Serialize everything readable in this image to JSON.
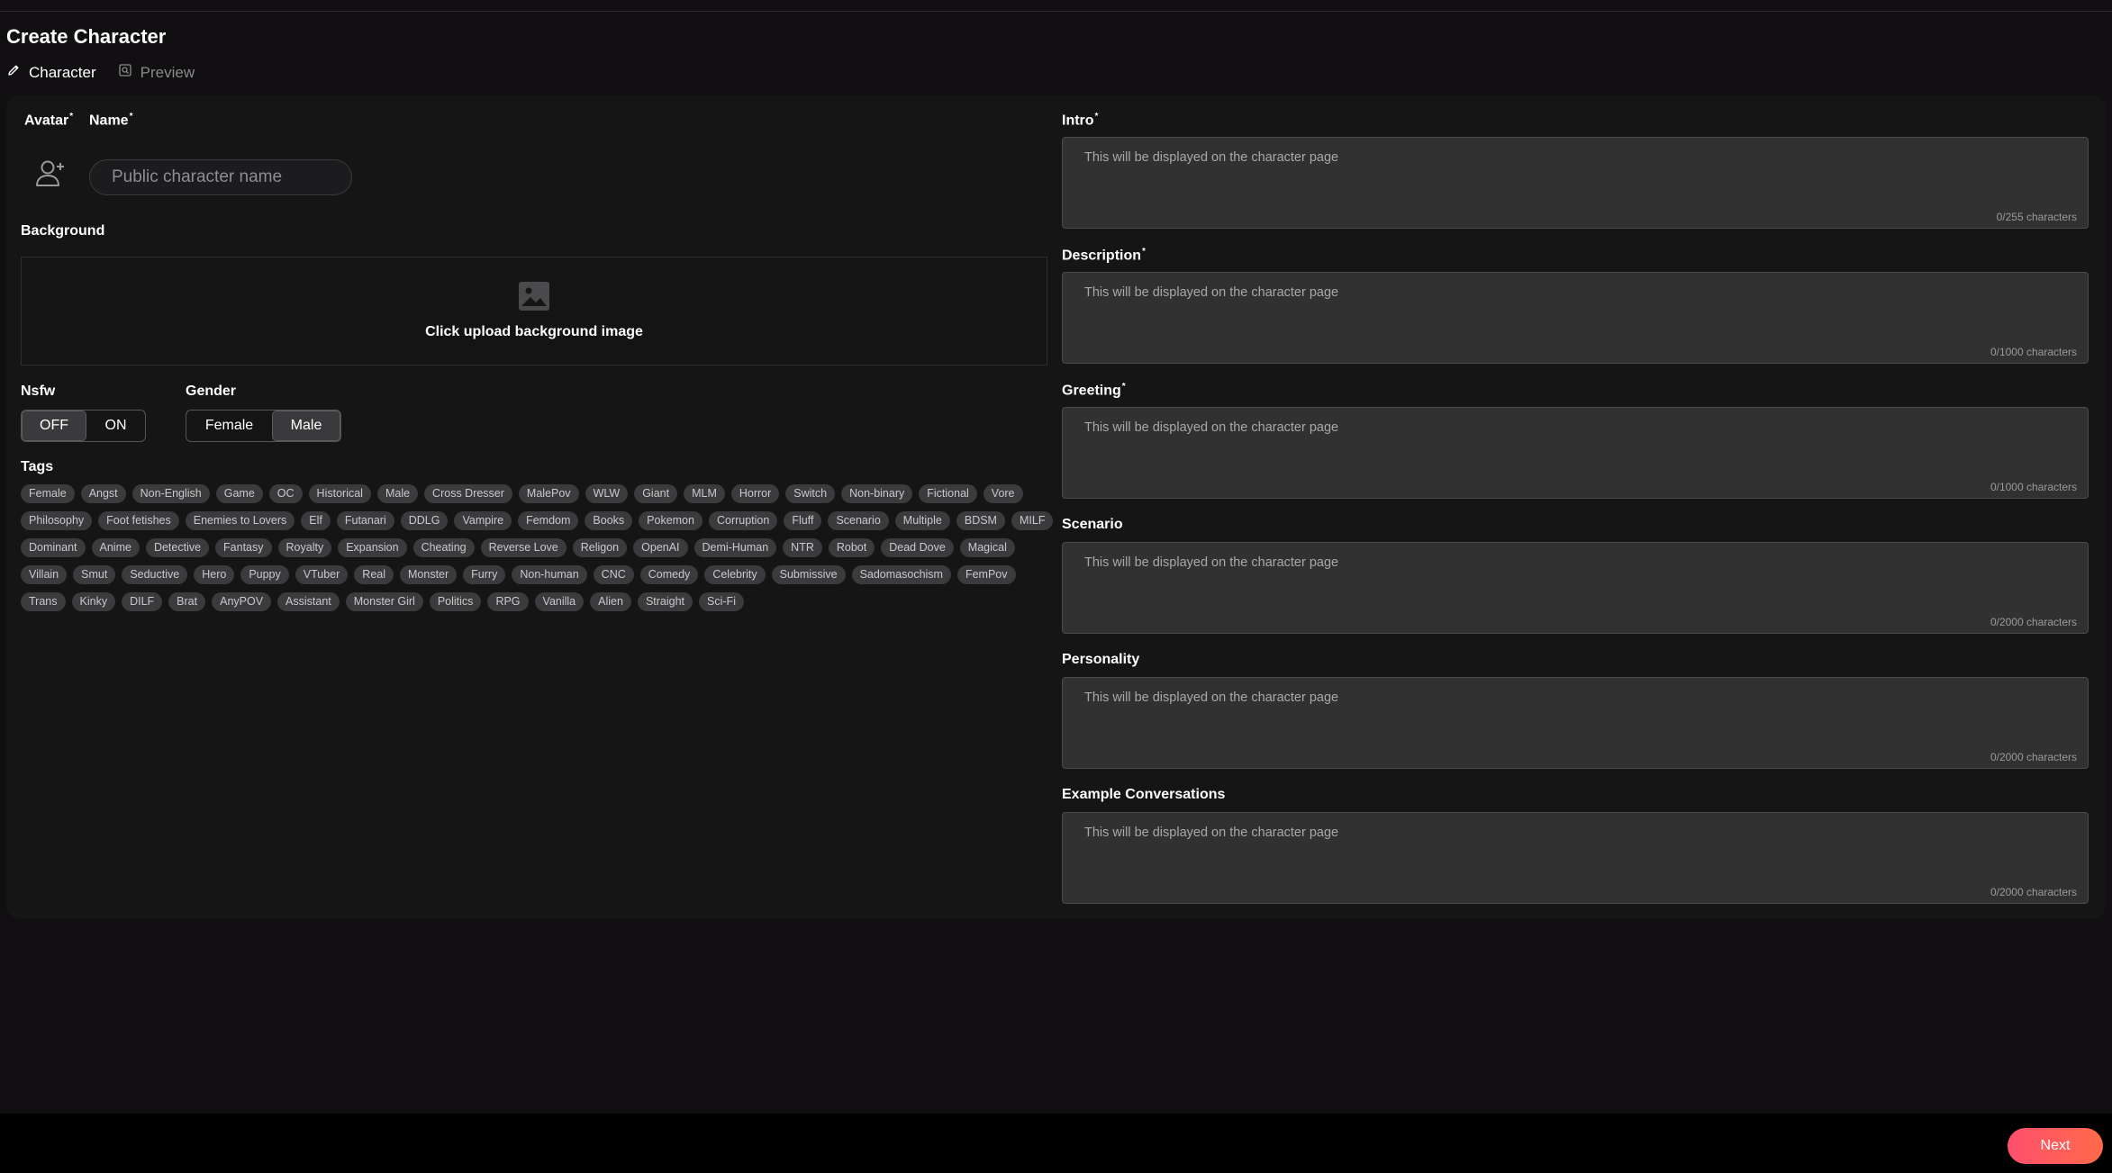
{
  "header": {
    "title": "Create Character"
  },
  "tabs": [
    {
      "label": "Character",
      "icon": "pencil-icon",
      "active": true
    },
    {
      "label": "Preview",
      "icon": "preview-icon",
      "active": false
    }
  ],
  "form": {
    "avatar_label": "Avatar",
    "name_label": "Name",
    "name_placeholder": "Public character name",
    "background_label": "Background",
    "background_upload_text": "Click upload background image",
    "nsfw": {
      "label": "Nsfw",
      "options": [
        "OFF",
        "ON"
      ],
      "selected": "OFF"
    },
    "gender": {
      "label": "Gender",
      "options": [
        "Female",
        "Male"
      ],
      "selected": "Male"
    },
    "tags_label": "Tags",
    "tags": [
      "Female",
      "Angst",
      "Non-English",
      "Game",
      "OC",
      "Historical",
      "Male",
      "Cross Dresser",
      "MalePov",
      "WLW",
      "Giant",
      "MLM",
      "Horror",
      "Switch",
      "Non-binary",
      "Fictional",
      "Vore",
      "Philosophy",
      "Foot fetishes",
      "Enemies to Lovers",
      "Elf",
      "Futanari",
      "DDLG",
      "Vampire",
      "Femdom",
      "Books",
      "Pokemon",
      "Corruption",
      "Fluff",
      "Scenario",
      "Multiple",
      "BDSM",
      "MILF",
      "Dominant",
      "Anime",
      "Detective",
      "Fantasy",
      "Royalty",
      "Expansion",
      "Cheating",
      "Reverse Love",
      "Religon",
      "OpenAI",
      "Demi-Human",
      "NTR",
      "Robot",
      "Dead Dove",
      "Magical",
      "Villain",
      "Smut",
      "Seductive",
      "Hero",
      "Puppy",
      "VTuber",
      "Real",
      "Monster",
      "Furry",
      "Non-human",
      "CNC",
      "Comedy",
      "Celebrity",
      "Submissive",
      "Sadomasochism",
      "FemPov",
      "Trans",
      "Kinky",
      "DILF",
      "Brat",
      "AnyPOV",
      "Assistant",
      "Monster Girl",
      "Politics",
      "RPG",
      "Vanilla",
      "Alien",
      "Straight",
      "Sci-Fi"
    ]
  },
  "fields": [
    {
      "label": "Intro",
      "required": true,
      "placeholder": "This will be displayed on the character page",
      "counter": "0/255 characters"
    },
    {
      "label": "Description",
      "required": true,
      "placeholder": "This will be displayed on the character page",
      "counter": "0/1000 characters"
    },
    {
      "label": "Greeting",
      "required": true,
      "placeholder": "This will be displayed on the character page",
      "counter": "0/1000 characters"
    },
    {
      "label": "Scenario",
      "required": false,
      "placeholder": "This will be displayed on the character page",
      "counter": "0/2000 characters"
    },
    {
      "label": "Personality",
      "required": false,
      "placeholder": "This will be displayed on the character page",
      "counter": "0/2000 characters"
    },
    {
      "label": "Example Conversations",
      "required": false,
      "placeholder": "This will be displayed on the character page",
      "counter": "0/2000 characters"
    }
  ],
  "footer": {
    "next_label": "Next"
  },
  "colors": {
    "accent_start": "#ff4f6e",
    "accent_end": "#ff6a49",
    "background": "#110f12",
    "panel": "#151515",
    "textarea": "#313131",
    "tag": "#3b3b3d"
  },
  "required_marker": "*"
}
